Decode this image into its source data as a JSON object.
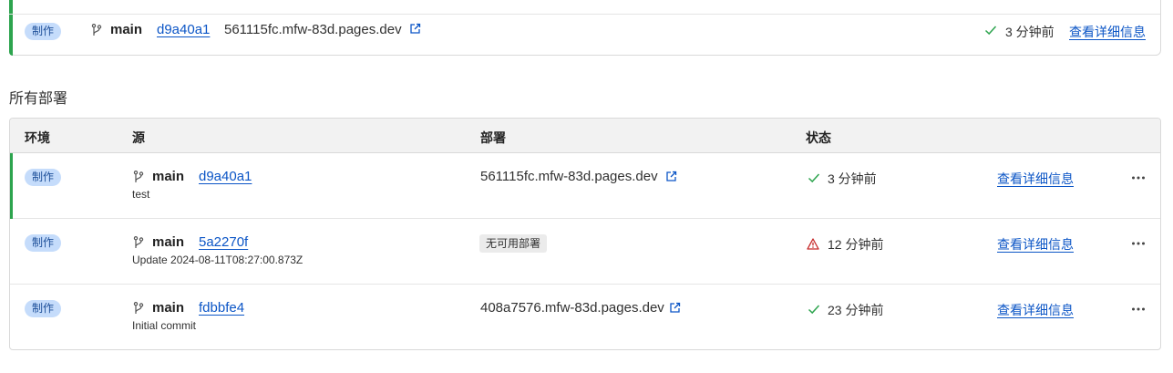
{
  "top_deployment": {
    "environment": "制作",
    "branch": "main",
    "commit": "d9a40a1",
    "url": "561115fc.mfw-83d.pages.dev",
    "status_time": "3 分钟前",
    "details_label": "查看详细信息"
  },
  "section_title": "所有部署",
  "table": {
    "headers": {
      "environment": "环境",
      "source": "源",
      "deployment": "部署",
      "status": "状态"
    },
    "rows": [
      {
        "environment": "制作",
        "branch": "main",
        "commit": "d9a40a1",
        "message": "test",
        "deployment": "561115fc.mfw-83d.pages.dev",
        "status": "success",
        "status_time": "3 分钟前",
        "details_label": "查看详细信息"
      },
      {
        "environment": "制作",
        "branch": "main",
        "commit": "5a2270f",
        "message": "Update 2024-08-11T08:27:00.873Z",
        "deployment": "无可用部署",
        "status": "warning",
        "status_time": "12 分钟前",
        "details_label": "查看详细信息"
      },
      {
        "environment": "制作",
        "branch": "main",
        "commit": "fdbbfe4",
        "message": "Initial commit",
        "deployment": "408a7576.mfw-83d.pages.dev",
        "status": "success",
        "status_time": "23 分钟前",
        "details_label": "查看详细信息"
      }
    ]
  },
  "colors": {
    "accent": "#0b55c6",
    "success": "#2da44e",
    "warning": "#c62828",
    "badge_bg": "#c5dcfb"
  }
}
